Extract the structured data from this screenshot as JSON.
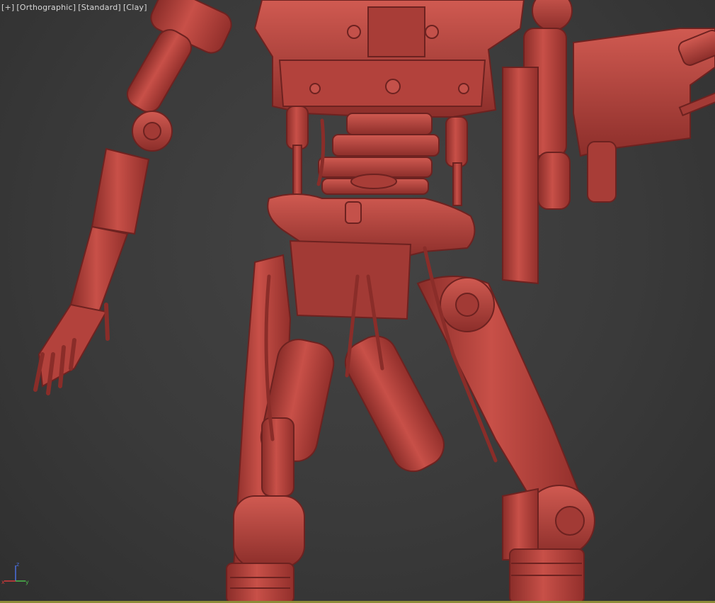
{
  "viewport": {
    "labels": {
      "plus": "[+]",
      "view": "[Orthographic]",
      "shading": "[Standard]",
      "style": "[Clay]"
    },
    "model": {
      "subject": "robot-endoskeleton",
      "clay_color": "#b8453f"
    },
    "gizmo": {
      "axes": [
        "z",
        "x",
        "y"
      ]
    }
  },
  "colors": {
    "background": "#3a3a3a",
    "clay": "#b8453f",
    "clay_light": "#d4655b",
    "clay_dark": "#7d2724",
    "label_text": "#d8d8d8",
    "axis_x": "#d23a3a",
    "axis_y": "#4cba4c",
    "axis_z": "#4a6fe0",
    "frame_rule": "#8d8b37"
  }
}
